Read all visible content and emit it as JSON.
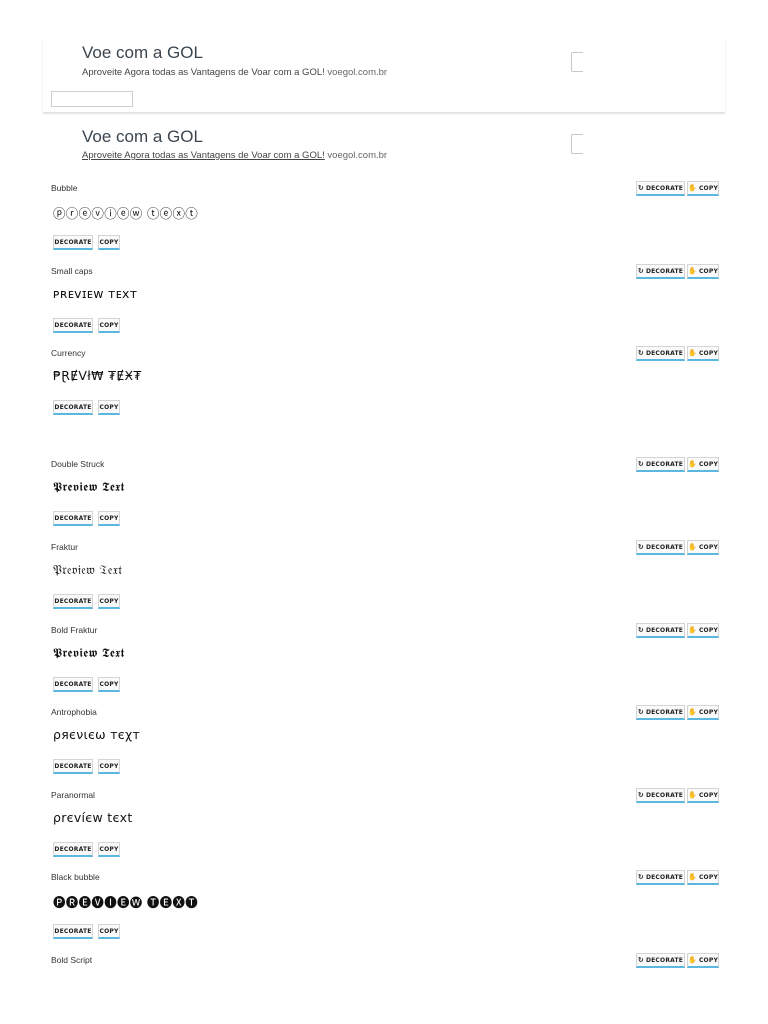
{
  "ads": [
    {
      "title": "Voe com a GOL",
      "description": "Aproveite Agora todas as Vantagens de Voar com a GOL!",
      "url": "voegol.com.br"
    },
    {
      "title": "Voe com a GOL",
      "description": "Aproveite Agora todas as Vantagens de Voar com a GOL!",
      "url": "voegol.com.br"
    }
  ],
  "buttons": {
    "decorate": "DECORATE",
    "copy": "COPY",
    "decorate_icon": "decorate-icon",
    "copy_icon": "copy-icon"
  },
  "styles": [
    {
      "name": "Bubble",
      "preview": "ⓟⓡⓔⓥⓘⓔⓦ ⓣⓔⓧⓣ"
    },
    {
      "name": "Small caps",
      "preview": "ᴘʀᴇᴠɪᴇᴡ ᴛᴇxᴛ"
    },
    {
      "name": "Currency",
      "preview": "₱ⱤɆVł₩ ₮ɆӾ₮"
    },
    {
      "name": "Double Struck",
      "preview": "𝕻𝖗𝖊𝖛𝖎𝖊𝖜 𝕿𝖊𝖝𝖙"
    },
    {
      "name": "Fraktur",
      "preview": "𝔓𝔯𝔢𝔳𝔦𝔢𝔴 𝔗𝔢𝔵𝔱"
    },
    {
      "name": "Bold Fraktur",
      "preview": "𝕻𝖗𝖊𝖛𝖎𝖊𝖜 𝕿𝖊𝖝𝖙"
    },
    {
      "name": "Antrophobia",
      "preview": "ρяєνιєω тєχт"
    },
    {
      "name": "Paranormal",
      "preview": "ρrєvíєw tєxt"
    },
    {
      "name": "Black bubble",
      "preview": "🅟🅡🅔🅥🅘🅔🅦 🅣🅔🅧🅣"
    },
    {
      "name": "Bold Script",
      "preview": ""
    }
  ],
  "colors": {
    "accent_underline": "#5ab8e0",
    "ad_title": "#3b4650"
  }
}
